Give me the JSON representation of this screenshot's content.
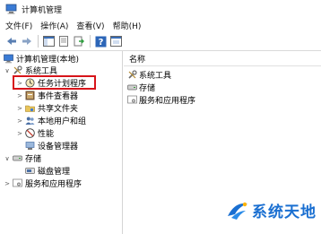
{
  "window": {
    "title": "计算机管理"
  },
  "menu": {
    "items": [
      "文件(F)",
      "操作(A)",
      "查看(V)",
      "帮助(H)"
    ]
  },
  "tree": {
    "root": "计算机管理(本地)",
    "system_tools": "系统工具",
    "task_scheduler": "任务计划程序",
    "event_viewer": "事件查看器",
    "shared_folders": "共享文件夹",
    "local_users": "本地用户和组",
    "performance": "性能",
    "device_manager": "设备管理器",
    "storage": "存储",
    "disk_management": "磁盘管理",
    "services": "服务和应用程序"
  },
  "list": {
    "header": "名称",
    "items": [
      "系统工具",
      "存储",
      "服务和应用程序"
    ]
  },
  "watermark": {
    "text": "系统天地"
  },
  "colors": {
    "highlight": "#d7141a",
    "watermark": "#1a6fd1"
  }
}
